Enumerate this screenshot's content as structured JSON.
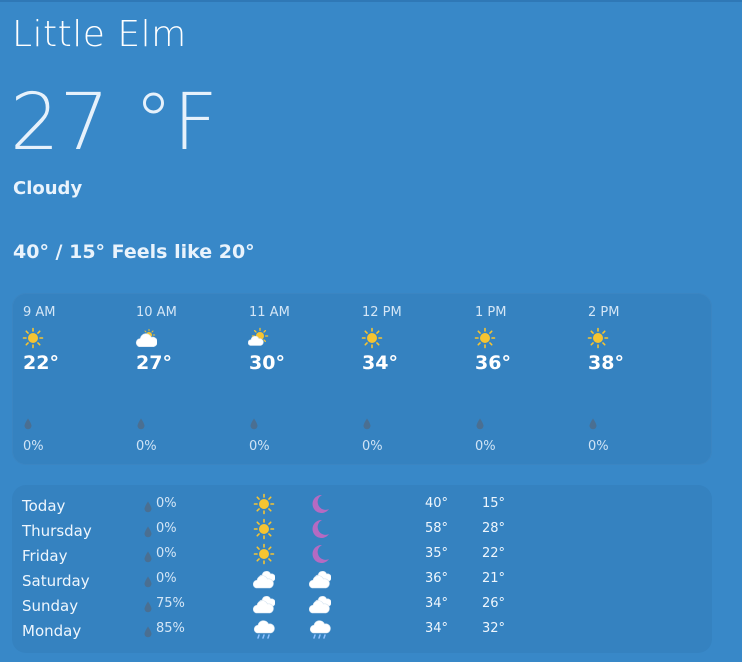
{
  "location": "Little Elm",
  "current": {
    "temperature": "27 °F",
    "condition": "Cloudy",
    "hi_lo_feels": "40° / 15° Feels like 20°"
  },
  "colors": {
    "background": "#3888c8",
    "panel": "#3582c0",
    "sun": "#f6c431",
    "moon": "#b56ac2",
    "drop": "#4a6f92"
  },
  "hourly": [
    {
      "time": "9 AM",
      "icon": "sun-icon",
      "temp": "22°",
      "precip": "0%"
    },
    {
      "time": "10 AM",
      "icon": "cloud-icon",
      "temp": "27°",
      "precip": "0%"
    },
    {
      "time": "11 AM",
      "icon": "partly-sunny-icon",
      "temp": "30°",
      "precip": "0%"
    },
    {
      "time": "12 PM",
      "icon": "sun-icon",
      "temp": "34°",
      "precip": "0%"
    },
    {
      "time": "1 PM",
      "icon": "sun-icon",
      "temp": "36°",
      "precip": "0%"
    },
    {
      "time": "2 PM",
      "icon": "sun-icon",
      "temp": "38°",
      "precip": "0%"
    }
  ],
  "daily": [
    {
      "day": "Today",
      "precip": "0%",
      "day_icon": "sun-icon",
      "night_icon": "moon-icon",
      "high": "40°",
      "low": "15°"
    },
    {
      "day": "Thursday",
      "precip": "0%",
      "day_icon": "sun-icon",
      "night_icon": "moon-icon",
      "high": "58°",
      "low": "28°"
    },
    {
      "day": "Friday",
      "precip": "0%",
      "day_icon": "sun-icon",
      "night_icon": "moon-icon",
      "high": "35°",
      "low": "22°"
    },
    {
      "day": "Saturday",
      "precip": "0%",
      "day_icon": "cloudy-icon",
      "night_icon": "cloudy-icon",
      "high": "36°",
      "low": "21°"
    },
    {
      "day": "Sunday",
      "precip": "75%",
      "day_icon": "cloudy-icon",
      "night_icon": "cloudy-icon",
      "high": "34°",
      "low": "26°"
    },
    {
      "day": "Monday",
      "precip": "85%",
      "day_icon": "rain-icon",
      "night_icon": "rain-icon",
      "high": "34°",
      "low": "32°"
    }
  ]
}
